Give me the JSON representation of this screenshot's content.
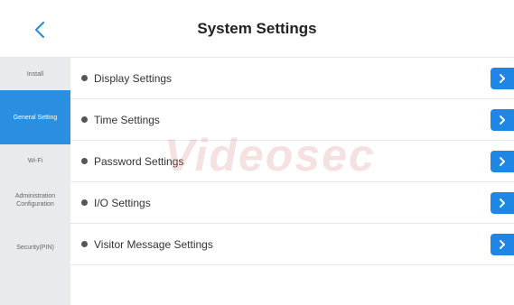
{
  "header": {
    "title": "System Settings",
    "back_icon": "chevron-left-icon"
  },
  "sidebar": {
    "items": [
      {
        "label": "Install",
        "active": false
      },
      {
        "label": "General Setting",
        "active": true
      },
      {
        "label": "Wi-Fi",
        "active": false
      },
      {
        "label": "Administration Configuration",
        "active": false
      },
      {
        "label": "Security(PIN)",
        "active": false
      }
    ]
  },
  "settings": {
    "items": [
      {
        "label": "Display Settings"
      },
      {
        "label": "Time Settings"
      },
      {
        "label": "Password Settings"
      },
      {
        "label": "I/O Settings"
      },
      {
        "label": "Visitor Message Settings"
      }
    ]
  },
  "watermark": "Videosec",
  "colors": {
    "accent": "#1e87e5",
    "sidebar_active": "#2a8fe0",
    "sidebar_bg": "#e9eaed"
  }
}
